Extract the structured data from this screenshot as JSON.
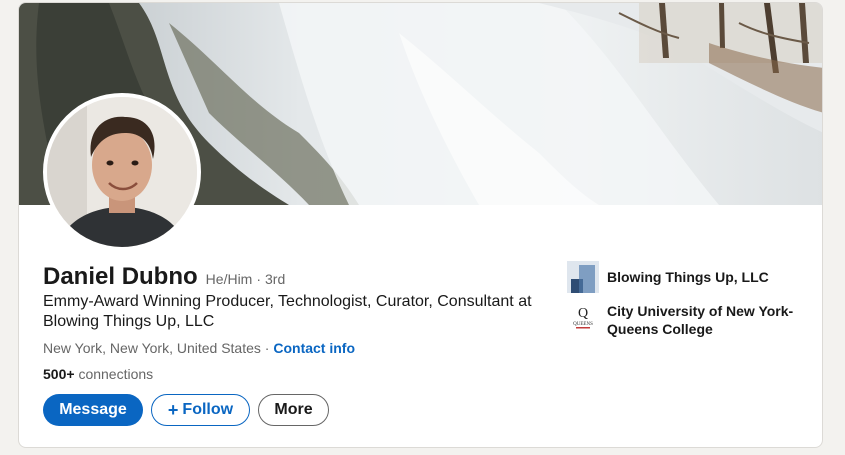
{
  "profile": {
    "name": "Daniel Dubno",
    "pronouns": "He/Him",
    "separator": "·",
    "degree": "3rd",
    "headline": "Emmy-Award Winning Producer, Technologist, Curator, Consultant at Blowing Things Up, LLC",
    "location": "New York, New York, United States",
    "location_separator": "·",
    "contact_label": "Contact info",
    "connections_count": "500+",
    "connections_label": "connections"
  },
  "actions": {
    "message_label": "Message",
    "follow_label": "Follow",
    "follow_icon": "+",
    "more_label": "More"
  },
  "organizations": [
    {
      "name": "Blowing Things Up, LLC",
      "icon": "company-logo"
    },
    {
      "name": "City University of New York-Queens College",
      "logo_text": "QUEENS",
      "icon": "school-logo"
    }
  ],
  "colors": {
    "accent": "#0a66c2",
    "text_primary": "#191919",
    "text_secondary": "#666666",
    "background": "#f3f2ef"
  }
}
